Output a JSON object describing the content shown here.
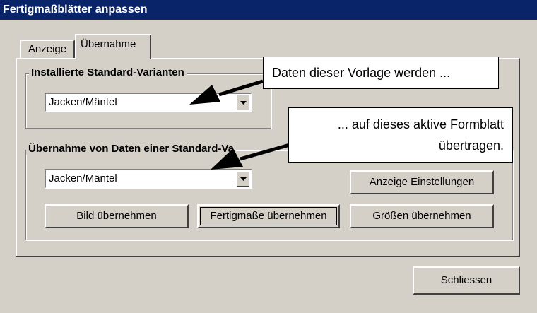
{
  "window": {
    "title": "Fertigmaßblätter anpassen"
  },
  "tabs": [
    {
      "label": "Anzeige"
    },
    {
      "label": "Übernahme"
    }
  ],
  "group1": {
    "title": "Installierte Standard-Varianten",
    "combo_value": "Jacken/Mäntel"
  },
  "group2": {
    "title": "Übernahme von Daten einer Standard-Va",
    "combo_value": "Jacken/Mäntel",
    "buttons": {
      "anzeige_einstellungen": "Anzeige Einstellungen",
      "bild": "Bild übernehmen",
      "fertigmasse": "Fertigmaße übernehmen",
      "groessen": "Größen übernehmen"
    }
  },
  "footer": {
    "close": "Schliessen"
  },
  "callouts": {
    "first": "Daten dieser Vorlage werden ...",
    "second_line1": "... auf dieses aktive Formblatt",
    "second_line2": "übertragen."
  },
  "colors": {
    "titlebar": "#0a246a",
    "face": "#d4d0c8"
  },
  "icons": {
    "dropdown": "chevron-down-icon",
    "annotation": "arrow-icon"
  }
}
